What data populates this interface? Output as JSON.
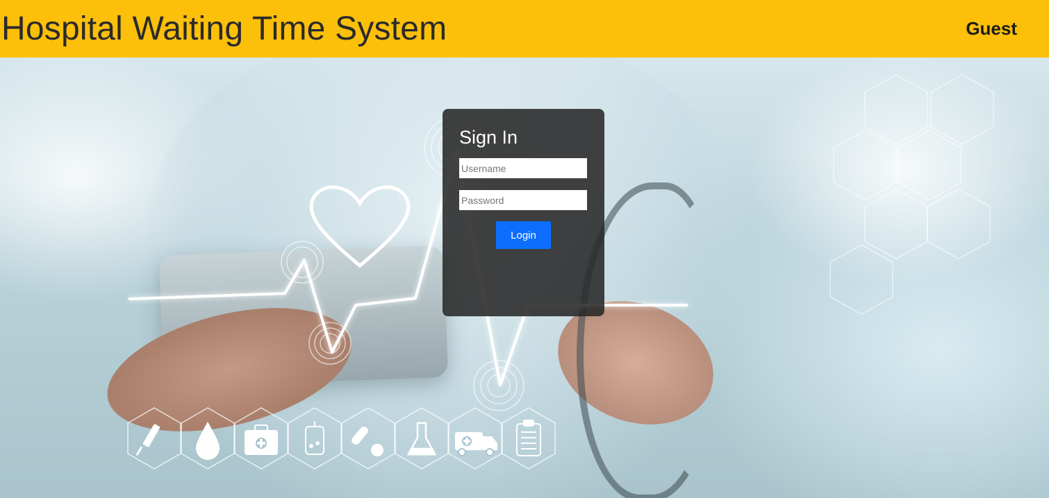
{
  "header": {
    "title": "Hospital Waiting Time System",
    "user": "Guest"
  },
  "login": {
    "heading": "Sign In",
    "username_placeholder": "Username",
    "password_placeholder": "Password",
    "button_label": "Login"
  },
  "colors": {
    "header_bg": "#fcbf0a",
    "card_bg": "#282828",
    "button_bg": "#0d6efd"
  },
  "decor_icons": [
    "syringe-icon",
    "blood-drop-icon",
    "first-aid-kit-icon",
    "iv-bag-icon",
    "pills-icon",
    "flask-icon",
    "ambulance-icon",
    "clipboard-icon"
  ]
}
